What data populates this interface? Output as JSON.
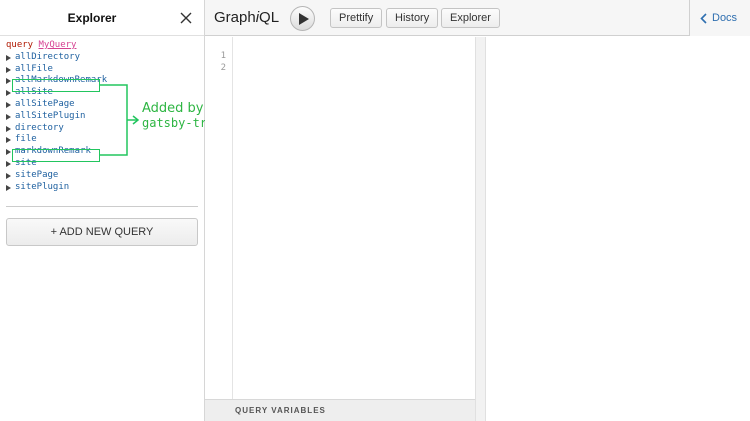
{
  "explorer": {
    "title": "Explorer",
    "query_keyword": "query",
    "query_name": "MyQuery",
    "fields": [
      "allDirectory",
      "allFile",
      "allMarkdownRemark",
      "allSite",
      "allSitePage",
      "allSitePlugin",
      "directory",
      "file",
      "markdownRemark",
      "site",
      "sitePage",
      "sitePlugin"
    ],
    "add_query_label": "+ ADD NEW QUERY"
  },
  "annotation": {
    "line1": "Added by",
    "line2": "gatsby-transformer-remark",
    "color": "#22c55e"
  },
  "toolbar": {
    "logo_pre": "Graph",
    "logo_i": "i",
    "logo_post": "QL",
    "prettify_label": "Prettify",
    "history_label": "History",
    "explorer_label": "Explorer",
    "docs_label": "Docs"
  },
  "editor": {
    "line_numbers": [
      "1",
      "2"
    ],
    "variables_label": "QUERY VARIABLES"
  }
}
